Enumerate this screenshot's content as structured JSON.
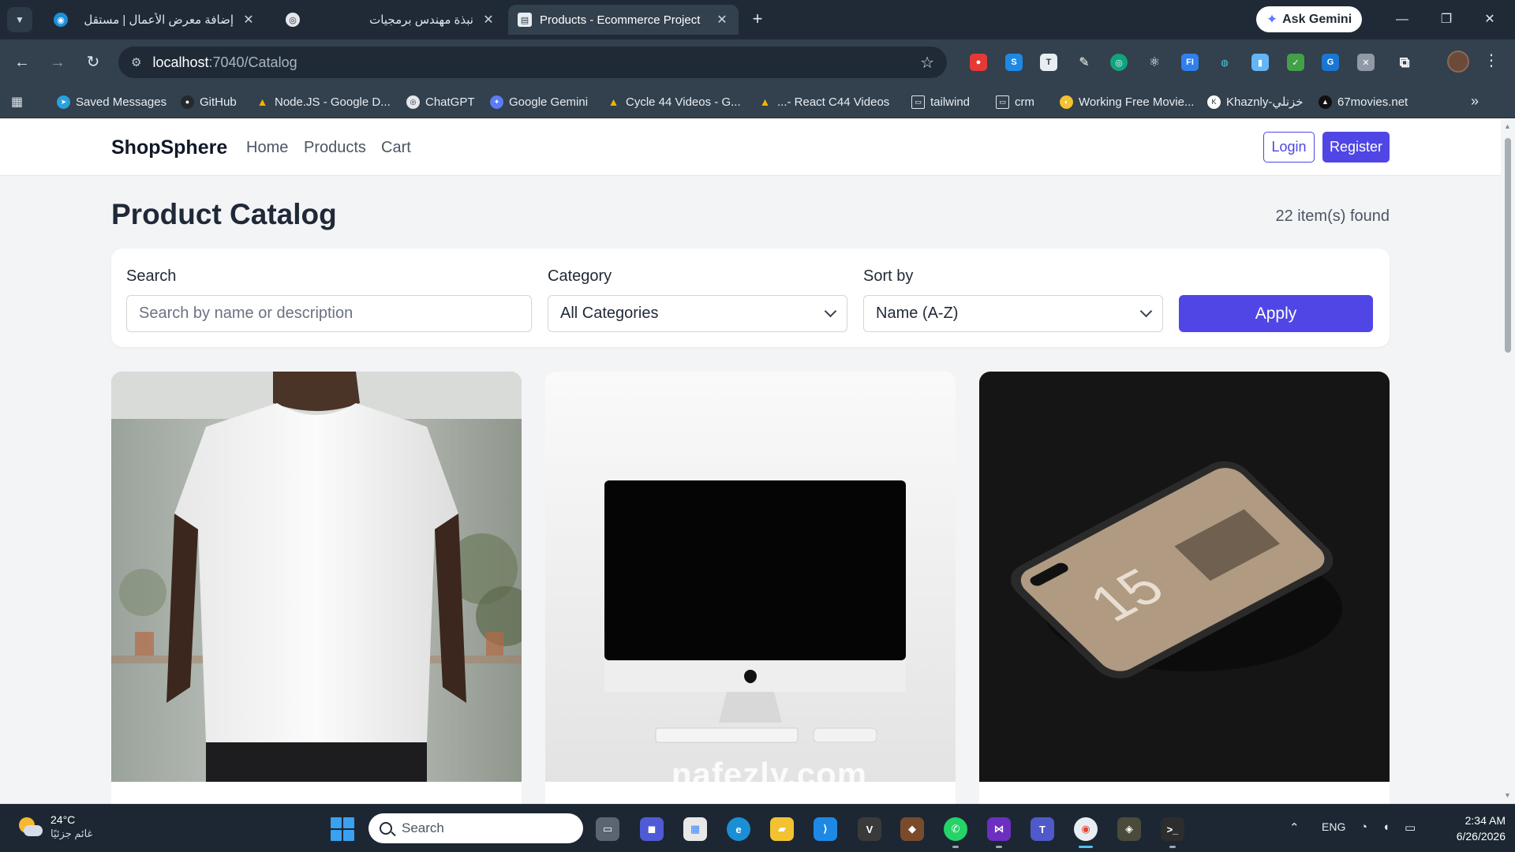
{
  "browser": {
    "tabs": [
      {
        "title": "إضافة معرض الأعمال | مستقل",
        "active": false
      },
      {
        "title": "نبذة مهندس برمجيات",
        "active": false
      },
      {
        "title": "Products - Ecommerce Project",
        "active": true
      }
    ],
    "ask_gemini": "Ask Gemini",
    "url_host": "localhost",
    "url_path": ":7040/Catalog",
    "bookmarks": [
      {
        "label": "Saved Messages",
        "icon": "telegram-icon",
        "color": "#2aa1da"
      },
      {
        "label": "GitHub",
        "icon": "github-icon",
        "color": "#24292e"
      },
      {
        "label": "Node.JS - Google D...",
        "icon": "google-drive-icon",
        "color": "#f4b400"
      },
      {
        "label": "ChatGPT",
        "icon": "chatgpt-icon",
        "color": "#e5e7eb"
      },
      {
        "label": "Google Gemini",
        "icon": "gemini-icon",
        "color": "#5b7cf6"
      },
      {
        "label": "Cycle 44 Videos - G...",
        "icon": "google-drive-icon",
        "color": "#f4b400"
      },
      {
        "label": "...- React C44 Videos",
        "icon": "google-drive-icon",
        "color": "#f4b400"
      },
      {
        "label": "tailwind",
        "icon": "folder-icon",
        "color": "#33404d"
      },
      {
        "label": "crm",
        "icon": "folder-icon",
        "color": "#33404d"
      },
      {
        "label": "Working Free Movie...",
        "icon": "movie-icon",
        "color": "#f2c230"
      },
      {
        "label": "Khaznly-خزنلي",
        "icon": "khaznly-icon",
        "color": "#ffffff"
      },
      {
        "label": "67movies.net",
        "icon": "movies-icon",
        "color": "#111111"
      }
    ]
  },
  "site": {
    "brand": "ShopSphere",
    "nav": [
      "Home",
      "Products",
      "Cart"
    ],
    "login": "Login",
    "register": "Register",
    "accent": "#4f46e5"
  },
  "catalog": {
    "title": "Product Catalog",
    "count": "22 item(s) found",
    "search_label": "Search",
    "search_placeholder": "Search by name or description",
    "category_label": "Category",
    "category_value": "All Categories",
    "sort_label": "Sort by",
    "sort_value": "Name (A-Z)",
    "apply": "Apply",
    "products": [
      {
        "image": "white-tshirt"
      },
      {
        "image": "imac-computer"
      },
      {
        "image": "iphone-15"
      }
    ]
  },
  "watermark": "nafezly.com",
  "taskbar": {
    "temperature": "24°C",
    "condition": "غائم جزئيًا",
    "search": "Search",
    "language": "ENG",
    "time": "2:34 AM",
    "date": "6/26/2026"
  }
}
